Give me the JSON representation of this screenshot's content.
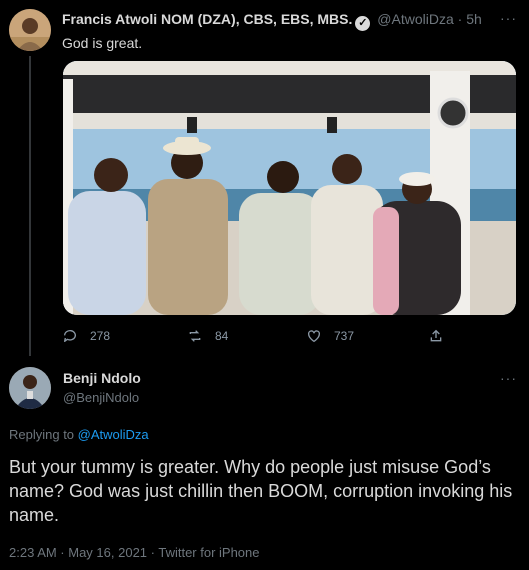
{
  "tweet1": {
    "author_name": "Francis Atwoli NOM (DZA), CBS, EBS, MBS.",
    "handle": "@AtwoliDza",
    "time": "5h",
    "separator": "·",
    "text": "God is great.",
    "replies": "278",
    "retweets": "84",
    "likes": "737",
    "more": "···"
  },
  "tweet2": {
    "author_name": "Benji Ndolo",
    "handle": "@BenjiNdolo",
    "replying_prefix": "Replying to",
    "replying_to": "@AtwoliDza",
    "text": "But your tummy is greater. Why do people just misuse God’s name? God was just chillin then BOOM, corruption invoking his name.",
    "timestamp": "2:23 AM · May 16, 2021 · Twitter for iPhone",
    "more": "···"
  },
  "colors": {
    "background": "#000000",
    "text": "#d9d9d9",
    "muted": "#6e767d",
    "link": "#1d9bf0"
  }
}
